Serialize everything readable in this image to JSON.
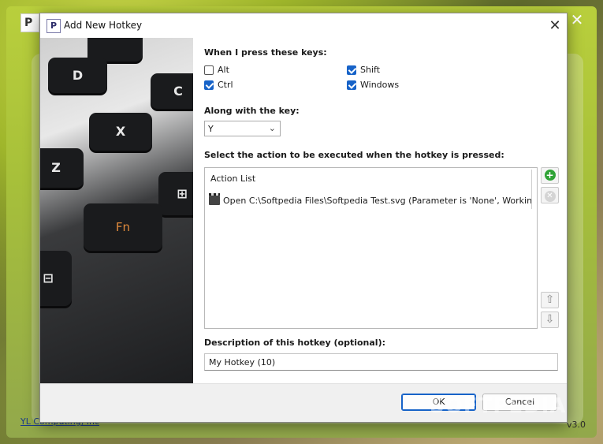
{
  "parent": {
    "app_icon_letter": "P",
    "close_glyph": "✕",
    "link_text": "YL Computing, Inc",
    "version": "v3.0",
    "watermark": "SOFTPEDIA"
  },
  "dialog": {
    "title": "Add New Hotkey",
    "title_icon_letter": "P",
    "close_glyph": "✕"
  },
  "keys_image": {
    "keys": [
      "⊙",
      "D",
      "C",
      "X",
      "Z",
      "Fn",
      "⊞",
      "⊟"
    ]
  },
  "form": {
    "press_keys_label": "When I press these keys:",
    "modifiers": [
      {
        "label": "Alt",
        "checked": false
      },
      {
        "label": "Shift",
        "checked": true
      },
      {
        "label": "Ctrl",
        "checked": true
      },
      {
        "label": "Windows",
        "checked": true
      }
    ],
    "along_with_label": "Along with the key:",
    "key_value": "Y",
    "action_label": "Select the action to be executed when the hotkey is pressed:",
    "action_list_header": "Action List",
    "actions": [
      "Open C:\\Softpedia Files\\Softpedia Test.svg (Parameter is 'None', Working ..."
    ],
    "description_label": "Description of this hotkey (optional):",
    "description_value": "My Hotkey (10)"
  },
  "side_buttons": {
    "add_glyph": "+",
    "remove_glyph": "✕",
    "up_glyph": "⇧",
    "down_glyph": "⇩"
  },
  "footer": {
    "ok_label": "OK",
    "cancel_label": "Cancel"
  }
}
